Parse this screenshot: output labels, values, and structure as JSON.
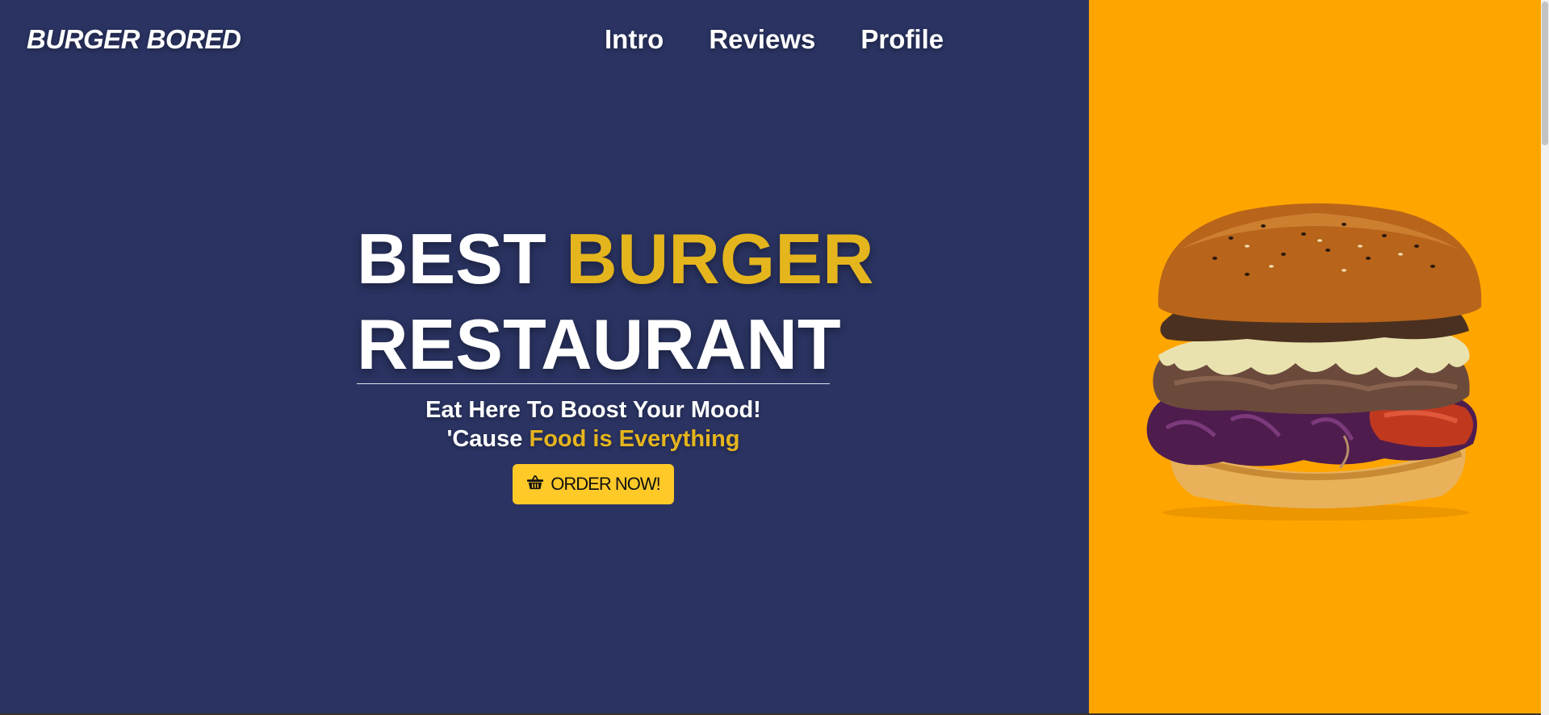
{
  "brand": {
    "name": "BURGER BORED"
  },
  "nav": {
    "items": [
      {
        "label": "Intro"
      },
      {
        "label": "Reviews"
      },
      {
        "label": "Profile"
      }
    ]
  },
  "hero": {
    "title_word1": "BEST",
    "title_word2": "BURGER",
    "title_line2": "RESTAURANT",
    "tagline1": "Eat Here To Boost Your Mood!",
    "tagline2_prefix": "'Cause",
    "tagline2_highlight": "Food is Everything",
    "cta_label": "ORDER NOW!"
  },
  "icons": {
    "cta": "shopping-basket-icon"
  },
  "colors": {
    "background": "#2a3361",
    "accent": "#e5b51e",
    "panel": "#ffa500",
    "button": "#ffc928",
    "text": "#ffffff"
  }
}
